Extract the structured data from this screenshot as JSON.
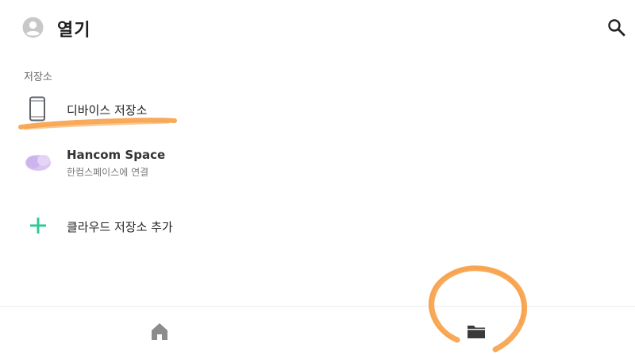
{
  "header": {
    "title": "열기",
    "avatar_icon": "account-circle-icon",
    "search_icon": "search-icon"
  },
  "section": {
    "label": "저장소"
  },
  "storage_items": [
    {
      "label": "디바이스 저장소",
      "icon": "smartphone-icon"
    },
    {
      "label": "Hancom Space",
      "sublabel": "한컴스페이스에 연결",
      "icon": "cloud-icon"
    },
    {
      "label": "클라우드 저장소 추가",
      "icon": "plus-icon"
    }
  ],
  "bottom_nav": {
    "items": [
      {
        "icon": "home-icon",
        "selected": false
      },
      {
        "icon": "folder-icon",
        "selected": true
      }
    ]
  },
  "colors": {
    "accent_green": "#2fc99a",
    "highlight_orange": "#f7a047",
    "cloud_purple": "#d9c4f2",
    "icon_gray": "#5f6368"
  }
}
